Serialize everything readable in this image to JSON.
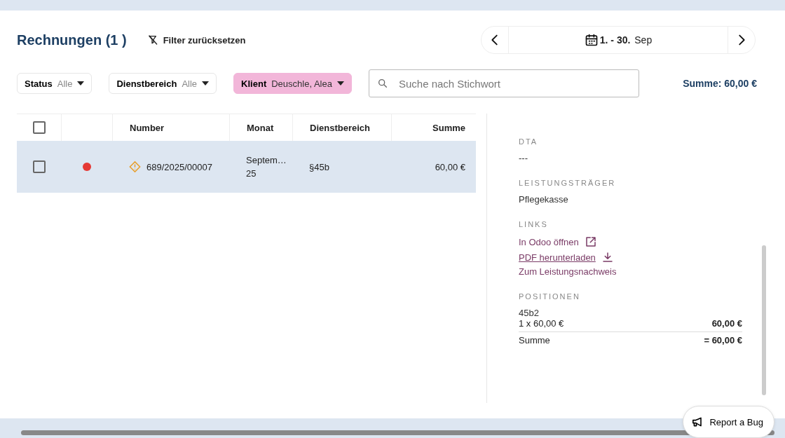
{
  "header": {
    "title": "Rechnungen (1 )",
    "reset_filters": "Filter zurücksetzen"
  },
  "date_nav": {
    "range_bold": "1. - 30.",
    "month": "Sep"
  },
  "filters": [
    {
      "label": "Status",
      "value": "Alle",
      "active": false
    },
    {
      "label": "Dienstbereich",
      "value": "Alle",
      "active": false
    },
    {
      "label": "Klient",
      "value": "Deuschle, Alea",
      "active": true
    }
  ],
  "search": {
    "placeholder": "Suche nach Stichwort"
  },
  "total": "Summe: 60,00 €",
  "table": {
    "select_all_checked": false,
    "columns": [
      "Number",
      "Monat",
      "Dienstbereich",
      "Summe"
    ],
    "rows": [
      {
        "selected": true,
        "checked": false,
        "color": "#e53935",
        "warning": true,
        "number": "689/2025/00007",
        "month": "Septem…\n25",
        "service": "§45b",
        "sum": "60,00 €"
      }
    ]
  },
  "details": {
    "sections": [
      {
        "kind": "value",
        "heading": "DTA",
        "value": "---"
      },
      {
        "kind": "value",
        "heading": "LEISTUNGSTRÄGER",
        "value": "Pflegekasse"
      },
      {
        "kind": "links",
        "heading": "LINKS",
        "links": [
          {
            "label": "In Odoo öffnen",
            "underlined": false
          },
          {
            "label": "PDF herunterladen",
            "underlined": true
          },
          {
            "label": "Zum Leistungsnachweis",
            "underlined": false
          }
        ]
      },
      {
        "kind": "positions",
        "heading": "POSITIONEN",
        "name": "45b2",
        "line": "1 x 60,00 €",
        "line_total": "60,00 €",
        "sum_label": "Summe",
        "sum_value": "= 60,00 €"
      }
    ]
  },
  "report_bug": "Report a Bug"
}
